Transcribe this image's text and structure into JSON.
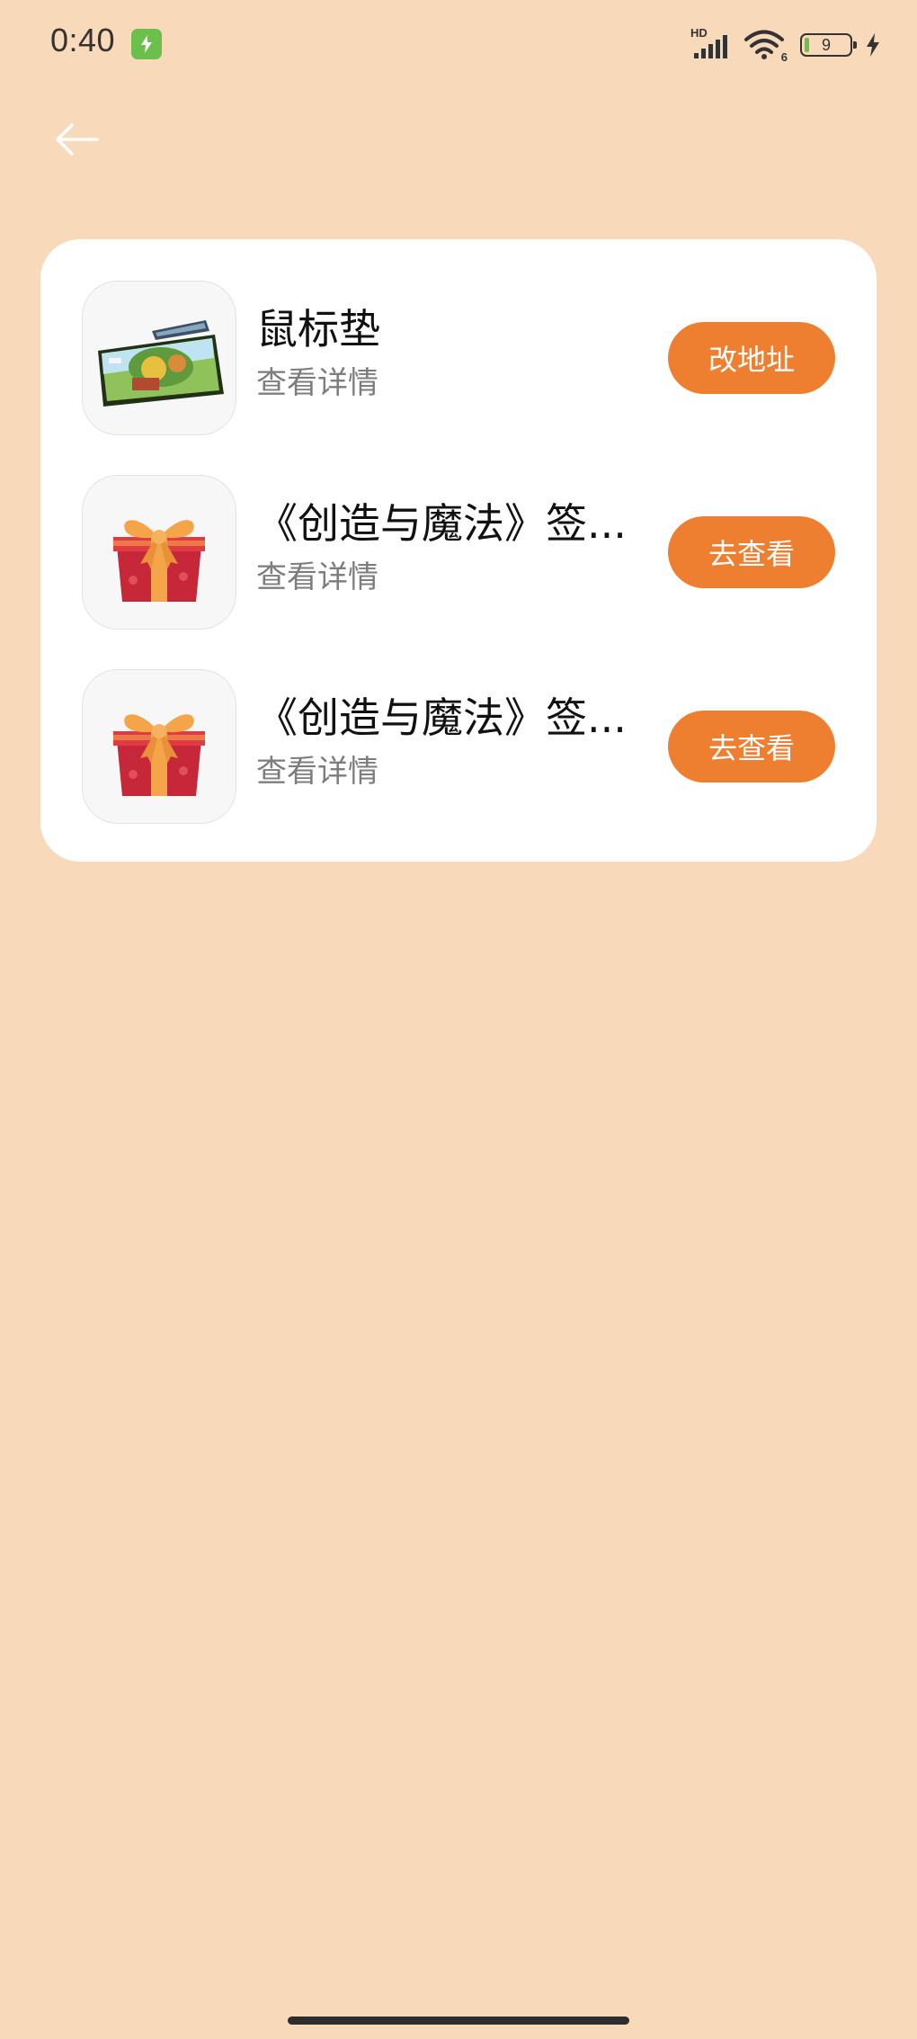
{
  "status_bar": {
    "time": "0:40",
    "network_label": "HD",
    "wifi_label": "6",
    "battery_level": "9",
    "battery_fraction": 0.09
  },
  "back": {
    "icon": "arrow-left-icon"
  },
  "items": [
    {
      "title": "鼠标垫",
      "subtitle": "查看详情",
      "button": "改地址",
      "thumb_icon": "mousepad-image"
    },
    {
      "title": "《创造与魔法》签...",
      "subtitle": "查看详情",
      "button": "去查看",
      "thumb_icon": "gift-box-icon"
    },
    {
      "title": "《创造与魔法》签...",
      "subtitle": "查看详情",
      "button": "去查看",
      "thumb_icon": "gift-box-icon"
    }
  ],
  "colors": {
    "background": "#f8d9b9",
    "accent": "#ef7f30",
    "card": "#ffffff"
  }
}
